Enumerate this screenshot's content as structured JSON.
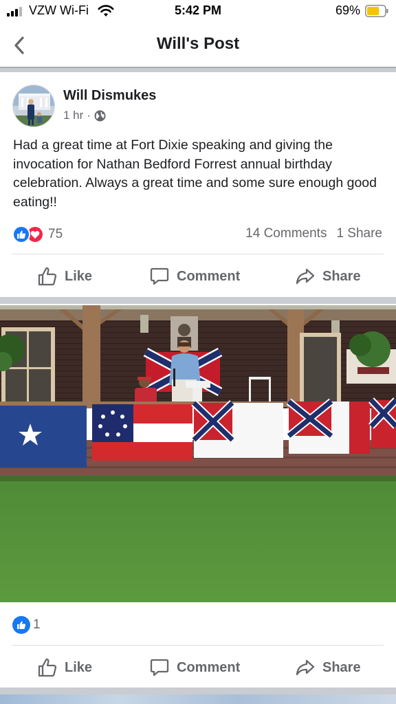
{
  "status_bar": {
    "carrier": "VZW Wi-Fi",
    "time": "5:42 PM",
    "battery_percent": "69%",
    "battery_level": 0.69,
    "battery_color": "#f5c400"
  },
  "nav": {
    "title": "Will's Post",
    "back_icon": "chevron-left-icon"
  },
  "post": {
    "author": "Will Dismukes",
    "time_ago": "1 hr",
    "separator": "·",
    "privacy_icon": "globe-icon",
    "text": "Had a great time at Fort Dixie speaking and giving the invocation for Nathan Bedford Forrest annual birthday celebration. Always a great time and some sure enough good eating!!",
    "reactions_count": "75",
    "comments": "14 Comments",
    "shares": "1 Share"
  },
  "actions": {
    "like": "Like",
    "comment": "Comment",
    "share": "Share"
  },
  "photo": {
    "reactions_count": "1"
  },
  "colors": {
    "like_blue": "#1877f2",
    "love_red": "#f0284a",
    "secondary_text": "#65676b",
    "divider": "#dadde1"
  }
}
